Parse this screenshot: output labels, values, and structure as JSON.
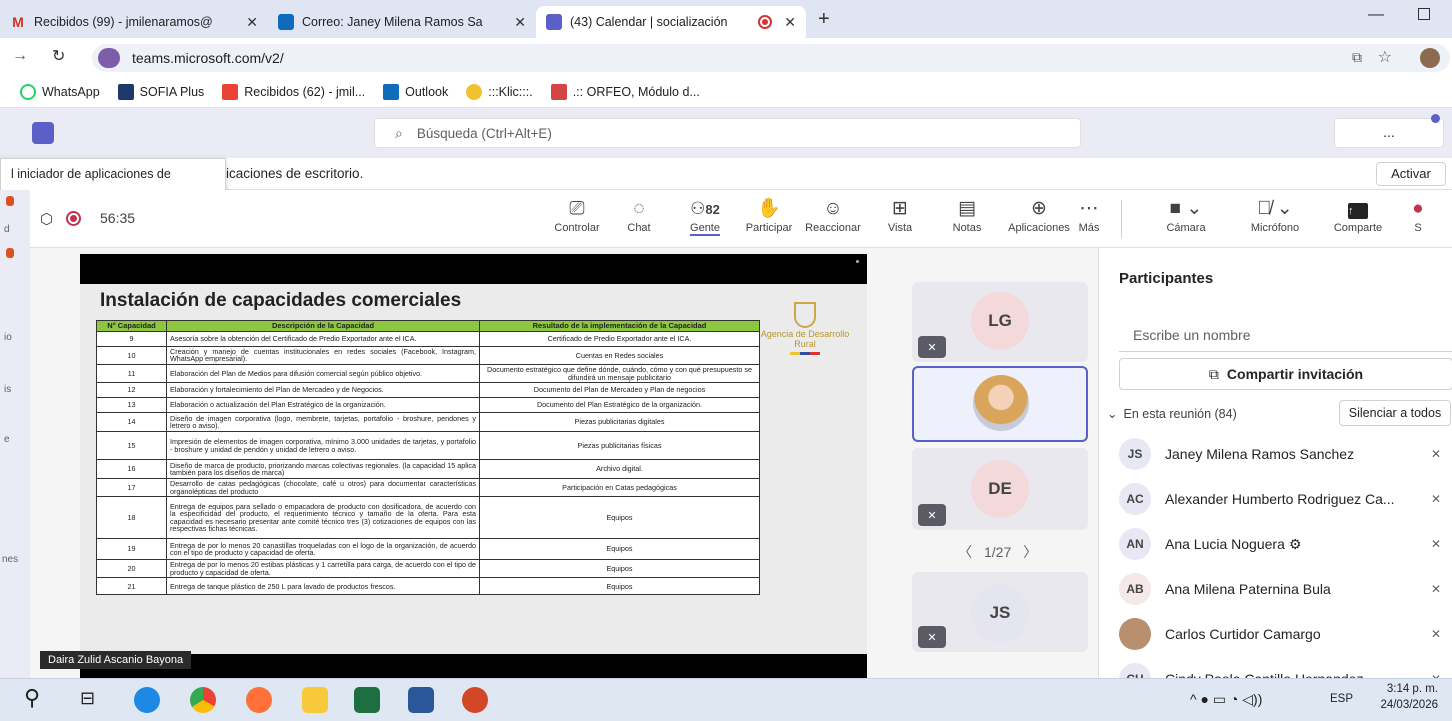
{
  "browser": {
    "tabs": [
      {
        "label": "Recibidos (99) - jmilenaramos@",
        "icon": "gmail-icon",
        "color": "#d93025"
      },
      {
        "label": "Correo: Janey Milena Ramos Sa",
        "icon": "outlook-icon",
        "color": "#0f6cbd"
      },
      {
        "label": "(43) Calendar | socialización",
        "icon": "teams-icon",
        "color": "#5b5fc7"
      }
    ],
    "new_tab": "+",
    "url": "teams.microsoft.com/v2/",
    "bookmarks": [
      "WhatsApp",
      "SOFIA Plus",
      "Recibidos (62) - jmil...",
      "Outlook",
      ":::Klic:::.",
      ".:: ORFEO, Módulo d..."
    ]
  },
  "teams": {
    "search_placeholder": "Búsqueda (Ctrl+Alt+E)",
    "more": "...",
    "notification": "icaciones de escritorio.",
    "activate": "Activar",
    "tooltip": "l iniciador de aplicaciones de",
    "rail_labels": [
      "d",
      "io",
      "is",
      "e",
      "nes"
    ]
  },
  "meeting": {
    "timer": "56:35",
    "people_count": "82",
    "toolbar": [
      "Controlar",
      "Chat",
      "Gente",
      "Participar",
      "Reaccionar",
      "Vista",
      "Notas",
      "Aplicaciones",
      "Más",
      "Cámara",
      "Micrófono",
      "Comparte",
      "S"
    ],
    "presenter": "Daira Zulid Ascanio Bayona",
    "page": "1/27"
  },
  "slide": {
    "title": "Instalación de capacidades comerciales",
    "logo": "Agencia de Desarrollo Rural",
    "headers": [
      "N° Capacidad",
      "Descripción de la Capacidad",
      "Resultado de la implementación de la Capacidad"
    ],
    "rows": [
      [
        "9",
        "Asesoría sobre la obtención del Certificado de Predio Exportador ante el ICA.",
        "Certificado de Predio Exportador ante el ICA."
      ],
      [
        "10",
        "Creación y manejo de cuentas institucionales en redes sociales (Facebook, Instagram, WhatsApp empresarial).",
        "Cuentas en Redes sociales"
      ],
      [
        "11",
        "Elaboración del Plan de Medios para difusión comercial según público objetivo.",
        "Documento estratégico que define dónde, cuándo, cómo y con qué presupuesto se difundirá un mensaje publicitario"
      ],
      [
        "12",
        "Elaboración y fortalecimiento del Plan de Mercadeo y de Negocios.",
        "Documento del Plan de Mercadeo y Plan de negocios"
      ],
      [
        "13",
        "Elaboración o actualización del Plan Estratégico de la organización.",
        "Documento del Plan Estratégico de la organización."
      ],
      [
        "14",
        "Diseño de imagen corporativa (logo, membrete, tarjetas, portafolio - broshure, pendones y letrero o aviso).",
        "Piezas publicitarias digitales"
      ],
      [
        "15",
        "Impresión de elementos de imagen corporativa, mínimo 3.000 unidades de tarjetas, y portafolio - broshure y unidad de pendón y unidad de letrero o aviso.",
        "Piezas publicitarias físicas"
      ],
      [
        "16",
        "Diseño de marca de producto, priorizando marcas colectivas regionales. (la capacidad 15 aplica también para los diseños de marca)",
        "Archivo digital."
      ],
      [
        "17",
        "Desarrollo de catas pedagógicas (chocolate, café u otros) para documentar características organolépticas del producto",
        "Participación en Catas pedagógicas"
      ],
      [
        "18",
        "Entrega de equipos para sellado o empacadora de producto con dosificadora, de acuerdo con la especificidad del producto, el requerimiento técnico y tamaño de la oferta. Para esta capacidad es necesario presentar ante comité técnico tres (3) cotizaciones de equipos con las respectivas fichas técnicas.",
        "Equipos"
      ],
      [
        "19",
        "Entrega de por lo menos 20 canastillas troqueladas con el logo de la organización, de acuerdo con el tipo de producto y capacidad de oferta.",
        "Equipos"
      ],
      [
        "20",
        "Entrega de por lo menos 20 estibas plásticas y 1 carretilla para carga, de acuerdo con el tipo de producto y capacidad de oferta.",
        "Equipos"
      ],
      [
        "21",
        "Entrega de tanque plástico de 250 L para lavado de productos frescos.",
        "Equipos"
      ]
    ]
  },
  "tiles": [
    {
      "initials": "LG",
      "color": "#f3d9d9"
    },
    {
      "initials": "",
      "color": "#d9dcef"
    },
    {
      "initials": "DE",
      "color": "#f3d9d9"
    },
    {
      "initials": "JS",
      "color": "#e5e5f0"
    }
  ],
  "participants": {
    "title": "Participantes",
    "search_placeholder": "Escribe un nombre",
    "invite": "Compartir invitación",
    "section": "En esta reunión (84)",
    "mute_all": "Silenciar a todos",
    "list": [
      {
        "initials": "JS",
        "name": "Janey Milena Ramos Sanchez",
        "color": "#e8e8f4"
      },
      {
        "initials": "AC",
        "name": "Alexander Humberto Rodriguez Ca...",
        "color": "#e8e8f4"
      },
      {
        "initials": "AN",
        "name": "Ana Lucia Noguera",
        "color": "#e8e8f4"
      },
      {
        "initials": "AB",
        "name": "Ana Milena Paternina Bula",
        "color": "#f4e8e8"
      },
      {
        "initials": "",
        "name": "Carlos Curtidor Camargo",
        "color": "#b89070"
      },
      {
        "initials": "CH",
        "name": "Cindy Paola Cantillo Hernandez",
        "color": "#e8e8f4"
      }
    ]
  },
  "taskbar": {
    "lang": "ESP",
    "time": "3:14 p. m.",
    "date": "24/03/2026"
  }
}
